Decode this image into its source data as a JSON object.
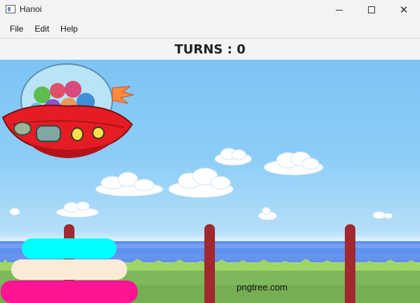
{
  "window": {
    "title": "Hanoi",
    "icon": "app-window-icon"
  },
  "menu": {
    "file": "File",
    "edit": "Edit",
    "help": "Help"
  },
  "game": {
    "turns_label": "TURNS : 0",
    "watermark": "pngtree.com",
    "rods": [
      "left",
      "middle",
      "right"
    ],
    "disks": [
      {
        "rod": "left",
        "size": 3,
        "color": "#ff1493"
      },
      {
        "rod": "left",
        "size": 2,
        "color": "#faebd7"
      },
      {
        "rod": "left",
        "size": 1,
        "color": "#00ffff"
      }
    ],
    "peg_color": "#a0282e"
  }
}
